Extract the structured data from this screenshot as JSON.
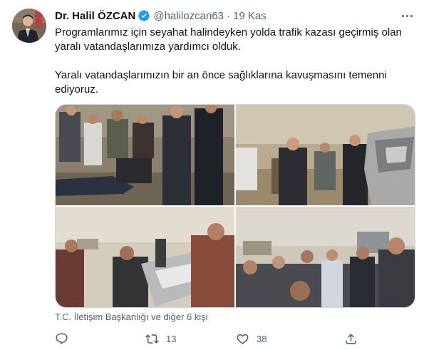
{
  "author": {
    "name": "Dr. Halil ÖZCAN",
    "handle": "@halilozcan63",
    "separator": "·",
    "time": "19 Kas",
    "verified": true
  },
  "tweet": {
    "paragraph_1": "Programlarımız için seyahat halindeyken yolda trafik kazası geçirmiş olan yaralı vatandaşlarımıza yardımcı olduk.",
    "paragraph_2": "Yaralı vatandaşlarımızın bir an önce sağlıklarına kavuşmasını temenni ediyoruz."
  },
  "media": {
    "photos": [
      "photo-1",
      "photo-2",
      "photo-3",
      "photo-4"
    ]
  },
  "tagged": "T.C. İletişim Başkanlığı ve diğer 6 kişi",
  "actions": {
    "reply_count": "",
    "retweet_count": "13",
    "like_count": "38",
    "icons": [
      "reply-icon",
      "retweet-icon",
      "heart-icon",
      "share-icon"
    ]
  },
  "colors": {
    "verified": "#1d9bf0",
    "secondary_text": "#536471",
    "border": "#cfd9de"
  }
}
